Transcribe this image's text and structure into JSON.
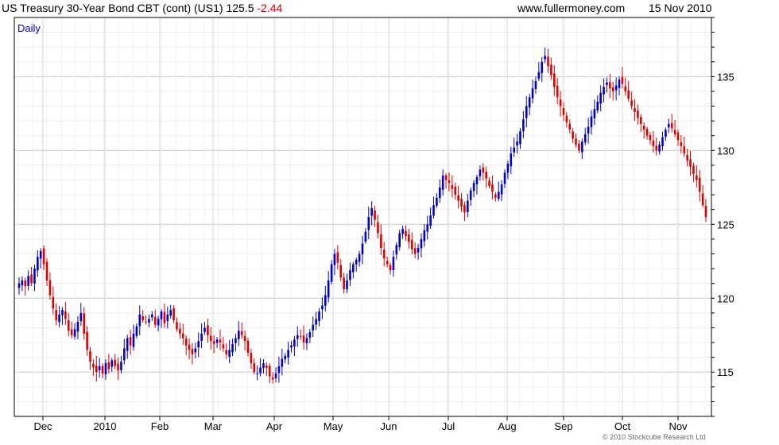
{
  "header": {
    "title": "US Treasury 30-Year  Bond CBT (cont) (US1) 125.5",
    "change": "-2.44",
    "site": "www.fullermoney.com",
    "date": "15 Nov 2010"
  },
  "copyright": "© 2010 Stockcube Research Ltd",
  "colors": {
    "up": "#0000cc",
    "down": "#dd0000",
    "grid": "#d8d8d8",
    "axis": "#000000",
    "tag": "#0000cc"
  },
  "chart_data": {
    "type": "candlestick",
    "interval_label": "Daily",
    "x_tick_labels": [
      "Dec",
      "2010",
      "Feb",
      "Mar",
      "Apr",
      "May",
      "Jun",
      "Jul",
      "Aug",
      "Sep",
      "Oct",
      "Nov"
    ],
    "y_tick_labels": [
      "135",
      "130",
      "125",
      "120",
      "115"
    ],
    "ylim": [
      112,
      139
    ],
    "grid": true,
    "last_value": 125.5,
    "change": -2.44,
    "closes": [
      121.0,
      121.2,
      120.8,
      121.5,
      121.0,
      122.0,
      122.8,
      123.2,
      122.3,
      121.2,
      120.2,
      119.3,
      118.5,
      118.9,
      119.2,
      118.6,
      117.8,
      117.5,
      117.9,
      118.4,
      119.0,
      117.6,
      116.5,
      115.7,
      115.3,
      115.0,
      115.4,
      114.9,
      115.6,
      115.2,
      115.8,
      115.4,
      115.1,
      115.7,
      116.6,
      117.3,
      116.8,
      117.6,
      118.1,
      118.9,
      118.5,
      118.4,
      118.6,
      118.9,
      118.2,
      118.6,
      119.1,
      118.3,
      118.9,
      119.2,
      118.5,
      117.9,
      117.6,
      117.3,
      116.8,
      116.5,
      116.2,
      116.6,
      117.1,
      117.6,
      118.0,
      117.5,
      117.1,
      116.9,
      117.2,
      117.0,
      116.6,
      116.2,
      116.5,
      116.9,
      117.3,
      117.8,
      117.5,
      117.1,
      116.3,
      115.6,
      115.0,
      114.9,
      115.3,
      115.6,
      115.3,
      114.7,
      114.5,
      114.9,
      115.4,
      115.9,
      116.1,
      116.5,
      116.8,
      117.2,
      117.5,
      117.4,
      117.0,
      117.3,
      117.7,
      118.2,
      118.6,
      119.1,
      119.5,
      120.2,
      121.2,
      122.3,
      123.0,
      122.4,
      121.4,
      120.6,
      121.2,
      121.9,
      122.3,
      122.6,
      123.0,
      123.7,
      124.5,
      125.5,
      126.1,
      125.3,
      124.4,
      123.4,
      122.7,
      122.3,
      121.9,
      122.8,
      123.6,
      124.4,
      124.7,
      124.2,
      123.8,
      123.3,
      123.0,
      123.4,
      124.0,
      124.6,
      125.0,
      125.6,
      126.3,
      126.8,
      127.5,
      128.3,
      128.0,
      127.8,
      127.4,
      127.0,
      126.6,
      126.2,
      125.8,
      126.6,
      127.3,
      127.8,
      128.2,
      128.7,
      128.5,
      128.1,
      127.6,
      127.2,
      126.8,
      127.2,
      127.7,
      128.5,
      129.1,
      129.8,
      130.2,
      130.6,
      131.3,
      132.1,
      133.0,
      133.6,
      134.2,
      134.7,
      135.3,
      136.0,
      136.4,
      135.7,
      135.1,
      134.3,
      133.6,
      133.0,
      132.4,
      131.9,
      131.4,
      130.8,
      130.4,
      130.0,
      130.6,
      131.1,
      131.6,
      132.3,
      132.8,
      133.3,
      133.9,
      134.3,
      134.6,
      134.2,
      134.0,
      134.4,
      134.8,
      134.5,
      134.0,
      133.5,
      133.0,
      132.6,
      132.2,
      131.8,
      131.4,
      131.0,
      130.7,
      130.3,
      130.0,
      130.4,
      130.9,
      131.4,
      131.8,
      131.5,
      131.1,
      130.7,
      130.3,
      129.8,
      129.3,
      128.9,
      128.4,
      128.0,
      127.2,
      126.3,
      125.5
    ]
  }
}
